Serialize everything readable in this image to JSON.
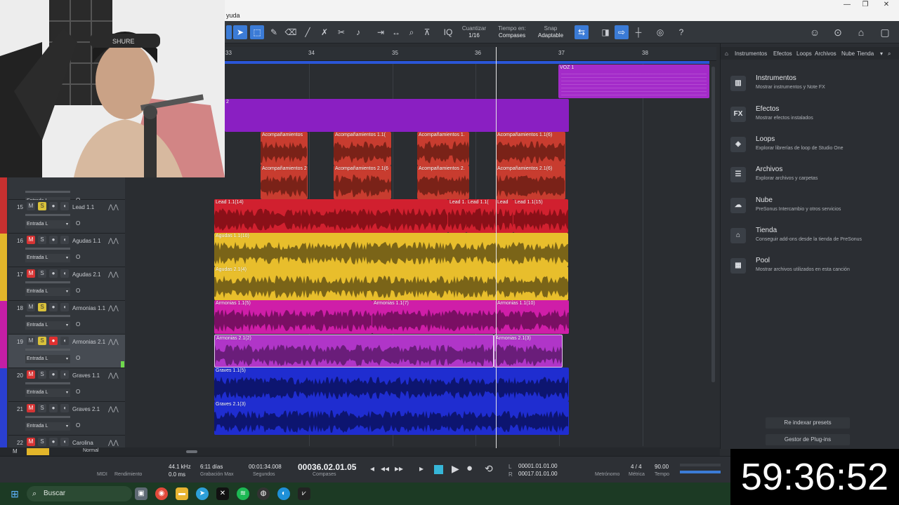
{
  "menu": {
    "visible_text": "yuda"
  },
  "toolbar": {
    "quantize_label": "Cuantizar",
    "quantize_value": "1/16",
    "timebase_label": "Tiempo en:",
    "timebase_value": "Compases",
    "snap_label": "Snap",
    "snap_value": "Adaptable",
    "iq": "IQ",
    "help": "?"
  },
  "ruler": {
    "bars": [
      "33",
      "34",
      "35",
      "36",
      "37",
      "38"
    ]
  },
  "tracks": [
    {
      "num": "",
      "name": "",
      "input": "Entrada L",
      "color": "#c73030"
    },
    {
      "num": "15",
      "name": "Lead 1.1",
      "input": "Entrada L",
      "color": "#c73030"
    },
    {
      "num": "16",
      "name": "Agudas 1.1",
      "input": "Entrada L",
      "color": "#e2b52a"
    },
    {
      "num": "17",
      "name": "Agudas 2.1",
      "input": "Entrada L",
      "color": "#e2b52a"
    },
    {
      "num": "18",
      "name": "Armonias 1.1",
      "input": "Entrada L",
      "color": "#c41ea5"
    },
    {
      "num": "19",
      "name": "Armonias 2.1",
      "input": "Entrada L",
      "color": "#c41ea5"
    },
    {
      "num": "20",
      "name": "Graves 1.1",
      "input": "Entrada L",
      "color": "#2a3fd0"
    },
    {
      "num": "21",
      "name": "Graves 2.1",
      "input": "Entrada L",
      "color": "#2a3fd0"
    },
    {
      "num": "22",
      "name": "Carolina",
      "input": "",
      "color": "#2a3fd0"
    }
  ],
  "track_buttons": {
    "m": "M",
    "s": "S",
    "rec": "●",
    "mon": "◖",
    "monitor_o": "O"
  },
  "events": {
    "voz": "VOZ 1",
    "purple_block": "2",
    "acomp_row1": [
      "Acompañamientos",
      "Acompañamientos 1.1(",
      "Acompañamientos 1.",
      "Acompañamientos 1.1(6)"
    ],
    "acomp_row2": [
      "Acompañamientos 2",
      "Acompañamientos 2.1(6",
      "Acompañamientos 2.",
      "Acompañamientos 2.1(6)"
    ],
    "lead": [
      "Lead 1.1(14)",
      "Lead 1.",
      "Lead 1.1(",
      "Lead",
      "Lead 1.1(15)"
    ],
    "agudas1": "Agudas 1.1(10)",
    "agudas2": "Agudas 2.1(4)",
    "armonias1": [
      "Armonias 1.1(5)",
      "Armonias 1.1(7)",
      "Armonias 1.1(10)"
    ],
    "armonias2": [
      "Armonias 2.1(2)",
      "Armonias 2.1(3)"
    ],
    "graves1": "Graves 1.1(5)",
    "graves2": "Graves 2.1(3)"
  },
  "browser": {
    "tabs": [
      "Instrumentos",
      "Efectos",
      "Loops",
      "Archivos",
      "Nube",
      "Tienda"
    ],
    "items": [
      {
        "icon": "piano-icon",
        "glyph": "▥",
        "title": "Instrumentos",
        "desc": "Mostrar instrumentos y Note FX"
      },
      {
        "icon": "fx-icon",
        "glyph": "FX",
        "title": "Efectos",
        "desc": "Mostrar efectos instalados"
      },
      {
        "icon": "loops-icon",
        "glyph": "◈",
        "title": "Loops",
        "desc": "Explorar librerías de loop de Studio One"
      },
      {
        "icon": "files-icon",
        "glyph": "☰",
        "title": "Archivos",
        "desc": "Explorar archivos y carpetas"
      },
      {
        "icon": "cloud-icon",
        "glyph": "☁",
        "title": "Nube",
        "desc": "PreSonus Intercambio y otros servicios"
      },
      {
        "icon": "store-icon",
        "glyph": "⌂",
        "title": "Tienda",
        "desc": "Conseguir add-ons desde la tienda de PreSonus"
      },
      {
        "icon": "pool-icon",
        "glyph": "▦",
        "title": "Pool",
        "desc": "Mostrar archivos utilizados en esta canción"
      }
    ],
    "reindex": "Re indexar presets",
    "plugin_manager": "Gestor de Plug-ins"
  },
  "bottom": {
    "mode_m": "M",
    "mode_normal": "Normal",
    "midi": "MIDI",
    "performance": "Rendimiento",
    "sample_rate": "44.1 kHz",
    "latency": "0.0 ms",
    "rec_days": "6:11 días",
    "rec_max": "Grabación Max",
    "seconds_val": "00:01:34.008",
    "seconds_label": "Segundos",
    "position": "00036.02.01.05",
    "position_label": "Compases",
    "loop_l": "00001.01.01.00",
    "loop_r": "00017.01.01.00",
    "l": "L",
    "r": "R",
    "metronome": "Metrónomo",
    "meter_val": "4 / 4",
    "meter_label": "Métrica",
    "tempo_val": "90.00",
    "tempo_label": "Tempo"
  },
  "clock": "59:36:52",
  "taskbar": {
    "search": "Buscar"
  }
}
